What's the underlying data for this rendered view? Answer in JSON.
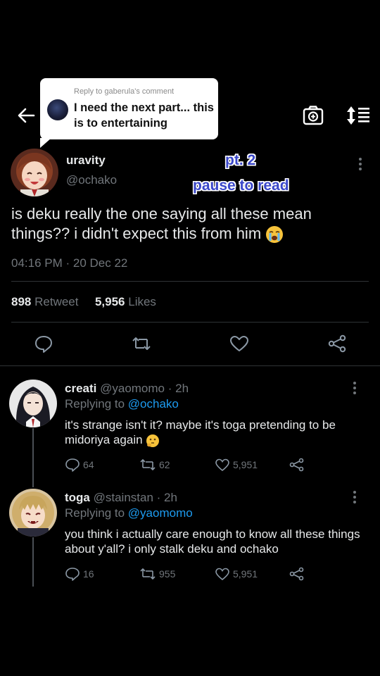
{
  "reply_bubble": {
    "context": "Reply to gaberula's comment",
    "text": "I need the next part... this is to entertaining"
  },
  "main_tweet": {
    "name": "uravity",
    "handle": "@ochako",
    "overlay_line1": "pt. 2",
    "overlay_line2": "pause to read",
    "text": "is deku really the one saying all these mean things?? i didn't expect this from him",
    "timestamp": "04:16 PM · 20 Dec 22",
    "retweet_count": "898",
    "retweet_label": "Retweet",
    "likes_count": "5,956",
    "likes_label": "Likes"
  },
  "replies": [
    {
      "name": "creati",
      "handle_time": "@yaomomo · 2h",
      "replying_prefix": "Replying to",
      "replying_to": "@ochako",
      "text": "it's strange isn't it? maybe it's toga pretending to be midoriya again",
      "replies": "64",
      "retweets": "62",
      "likes": "5,951"
    },
    {
      "name": "toga",
      "handle_time": "@stainstan · 2h",
      "replying_prefix": "Replying to",
      "replying_to": "@yaomomo",
      "text": "you think i actually care enough to know all these things about y'all? i only stalk deku and ochako",
      "replies": "16",
      "retweets": "955",
      "likes": "5,951"
    }
  ],
  "icons": {
    "back": "arrow-left-icon",
    "camera": "camera-icon",
    "sort": "sort-icon",
    "more": "more-vertical-icon",
    "reply": "comment-icon",
    "retweet": "retweet-icon",
    "like": "heart-icon",
    "share": "share-icon"
  },
  "colors": {
    "background": "#000000",
    "text": "#e7e9ea",
    "muted": "#71767b",
    "link": "#1d9bf0",
    "overlay": "#3a47c9"
  }
}
